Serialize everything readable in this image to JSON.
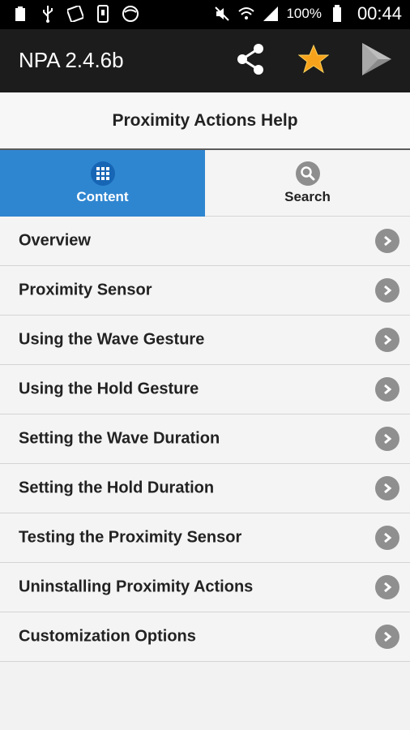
{
  "status_bar": {
    "left_icons": [
      "battery-100-icon",
      "usb-icon",
      "photo-icon",
      "phone-icon",
      "contrast-icon"
    ],
    "right_icons": [
      "mute-icon",
      "wifi-icon",
      "signal-icon",
      "battery-icon"
    ],
    "battery_percent": "100%",
    "time": "00:44"
  },
  "app_bar": {
    "title": "NPA 2.4.6b",
    "actions": [
      "share-icon",
      "star-icon",
      "play-store-icon"
    ],
    "star_color": "#f7a21b"
  },
  "header": {
    "title": "Proximity Actions Help"
  },
  "tabs": [
    {
      "label": "Content",
      "icon": "grid-icon",
      "active": true
    },
    {
      "label": "Search",
      "icon": "search-icon",
      "active": false
    }
  ],
  "colors": {
    "accent": "#2f86d0",
    "appbar": "#1c1c1c"
  },
  "list": {
    "items": [
      {
        "label": "Overview"
      },
      {
        "label": "Proximity Sensor"
      },
      {
        "label": "Using the Wave Gesture"
      },
      {
        "label": "Using the Hold Gesture"
      },
      {
        "label": "Setting the Wave Duration"
      },
      {
        "label": "Setting the Hold Duration"
      },
      {
        "label": "Testing the Proximity Sensor"
      },
      {
        "label": "Uninstalling Proximity Actions"
      },
      {
        "label": "Customization Options"
      }
    ]
  }
}
